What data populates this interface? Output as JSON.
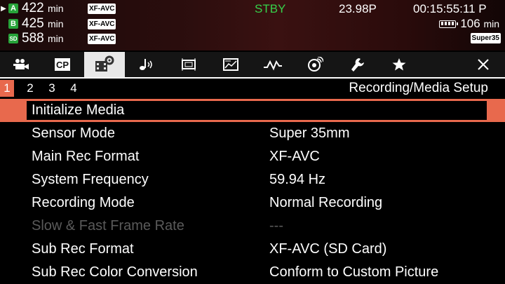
{
  "status": {
    "media": [
      {
        "slot": "A",
        "minutes": "422",
        "unit": "min",
        "format": "XF-AVC",
        "active": true
      },
      {
        "slot": "B",
        "minutes": "425",
        "unit": "min",
        "format": "XF-AVC",
        "active": false
      },
      {
        "slot": "SD",
        "minutes": "588",
        "unit": "min",
        "format": "XF-AVC",
        "active": false
      }
    ],
    "mode": "STBY",
    "frame_rate": "23.98P",
    "timecode": "00:15:55:11 P",
    "battery_minutes": "106",
    "battery_unit": "min",
    "sensor_badge": "Super35",
    "colors": {
      "stby": "#36d14a",
      "slot": "#27a33a",
      "accent": "#e8694d"
    }
  },
  "tabs": [
    {
      "icon": "camera-icon",
      "active": false
    },
    {
      "icon": "custom-picture-icon",
      "label": "CP",
      "active": false
    },
    {
      "icon": "recording-media-setup-icon",
      "active": true
    },
    {
      "icon": "audio-icon",
      "active": false
    },
    {
      "icon": "lcd-vf-icon",
      "active": false
    },
    {
      "icon": "tc-ub-icon",
      "active": false
    },
    {
      "icon": "monitoring-waveform-icon",
      "active": false
    },
    {
      "icon": "network-icon",
      "active": false
    },
    {
      "icon": "wrench-icon",
      "active": false
    },
    {
      "icon": "star-icon",
      "active": false
    },
    {
      "icon": "close-icon",
      "active": false
    }
  ],
  "pages": [
    "1",
    "2",
    "3",
    "4"
  ],
  "active_page": "1",
  "page_title": "Recording/Media Setup",
  "menu": [
    {
      "label": "Initialize Media",
      "value": ""
    },
    {
      "label": "Sensor Mode",
      "value": "Super 35mm"
    },
    {
      "label": "Main Rec Format",
      "value": "XF-AVC"
    },
    {
      "label": "System Frequency",
      "value": "59.94 Hz"
    },
    {
      "label": "Recording Mode",
      "value": "Normal Recording"
    },
    {
      "label": "Slow & Fast Frame Rate",
      "value": "---"
    },
    {
      "label": "Sub Rec Format",
      "value": "XF-AVC (SD Card)"
    },
    {
      "label": "Sub Rec Color Conversion",
      "value": "Conform to Custom Picture"
    }
  ]
}
